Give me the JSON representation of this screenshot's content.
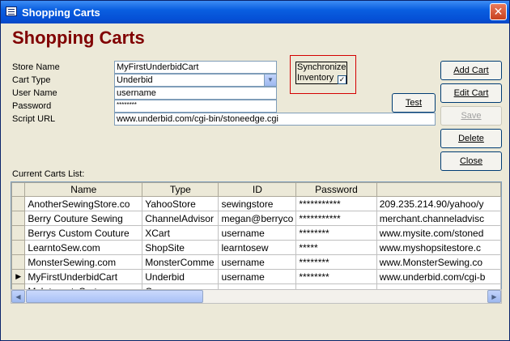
{
  "window": {
    "title": "Shopping Carts",
    "close_glyph": "✕"
  },
  "form": {
    "heading": "Shopping Carts",
    "store_name_label": "Store Name",
    "store_name_value": "MyFirstUnderbidCart",
    "cart_type_label": "Cart Type",
    "cart_type_value": "Underbid",
    "user_name_label": "User Name",
    "user_name_value": "username",
    "password_label": "Password",
    "password_value": "********",
    "script_url_label": "Script URL",
    "script_url_value": "www.underbid.com/cgi-bin/stoneedge.cgi",
    "sync_label_1": "Synchronize",
    "sync_label_2": "Inventory",
    "sync_checked": "✓"
  },
  "buttons": {
    "add": "Add Cart",
    "edit": "Edit Cart",
    "save": "Save",
    "delete": "Delete",
    "close": "Close",
    "test": "Test"
  },
  "grid": {
    "label": "Current Carts List:",
    "columns": [
      "Name",
      "Type",
      "ID",
      "Password",
      ""
    ],
    "rows": [
      [
        "AnotherSewingStore.co",
        "YahooStore",
        "sewingstore",
        "***********",
        "209.235.214.90/yahoo/y"
      ],
      [
        "Berry Couture Sewing",
        "ChannelAdvisor",
        "megan@berryco",
        "***********",
        "merchant.channeladvisc"
      ],
      [
        "Berrys Custom Couture",
        "XCart",
        "username",
        "********",
        "www.mysite.com/stoned"
      ],
      [
        "LearntoSew.com",
        "ShopSite",
        "learntosew",
        "*****",
        "www.myshopsitestore.c"
      ],
      [
        "MonsterSewing.com",
        "MonsterComme",
        "username",
        "********",
        "www.MonsterSewing.co"
      ],
      [
        "MyFirstUnderbidCart",
        "Underbid",
        "username",
        "********",
        "www.underbid.com/cgi-b"
      ],
      [
        "MyInternetsCart",
        "Commerce",
        "",
        "",
        ""
      ]
    ],
    "current_row_marker": "▶"
  }
}
